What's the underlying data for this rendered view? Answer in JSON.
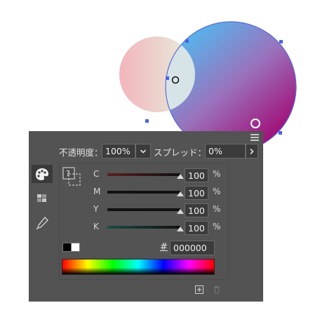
{
  "canvas": {
    "circle_small": {
      "fill_from": "#f2b9bd",
      "fill_to": "#e8eede"
    },
    "circle_large": {
      "fill_from": "#5ab0e8",
      "fill_mid": "#9a6bb8",
      "fill_to": "#a0107a",
      "stroke": "#5a6bd8"
    }
  },
  "panel": {
    "opacity_label": "不透明度：",
    "opacity_value": "100%",
    "spread_label": "スプレッド：",
    "spread_value": "0%",
    "channels": [
      {
        "label": "C",
        "value": "100",
        "unit": "%",
        "level": 1.0,
        "track_color": "#5a2020"
      },
      {
        "label": "M",
        "value": "100",
        "unit": "%",
        "level": 1.0,
        "track_color": "#111111"
      },
      {
        "label": "Y",
        "value": "100",
        "unit": "%",
        "level": 1.0,
        "track_color": "#111111"
      },
      {
        "label": "K",
        "value": "100",
        "unit": "%",
        "level": 1.0,
        "track_color": "#1e4a45"
      }
    ],
    "hash_label": "#",
    "hex_value": "000000",
    "unknown_color_glyph": "?"
  }
}
